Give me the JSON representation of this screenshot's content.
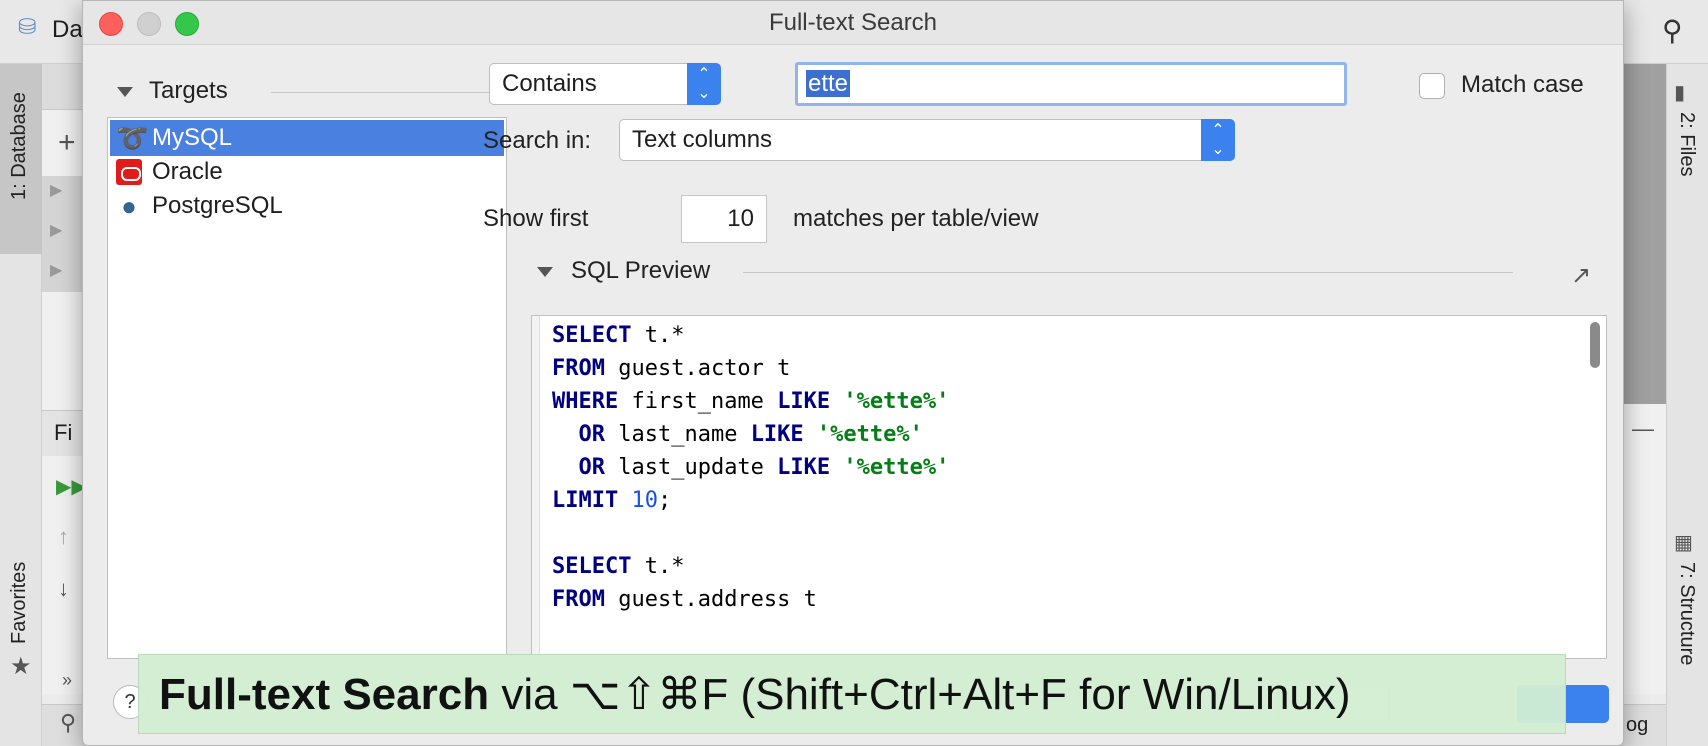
{
  "ide": {
    "left_tabs": {
      "database": "1: Database",
      "favorites": "Favorites"
    },
    "right_tabs": {
      "files": "2: Files",
      "structure": "7: Structure"
    },
    "db_panel_title": "Da",
    "find_panel_title": "Fi",
    "right_bottom_label": "og"
  },
  "dialog": {
    "title": "Full-text Search",
    "targets": {
      "header": "Targets",
      "items": [
        {
          "label": "MySQL",
          "icon": "mysql-dolphin-icon",
          "selected": true
        },
        {
          "label": "Oracle",
          "icon": "oracle-icon",
          "selected": false
        },
        {
          "label": "PostgreSQL",
          "icon": "postgresql-elephant-icon",
          "selected": false
        }
      ]
    },
    "match_mode": {
      "value": "Contains"
    },
    "search": {
      "value": "ette"
    },
    "match_case": {
      "label": "Match case",
      "checked": false
    },
    "search_in": {
      "label": "Search in:",
      "value": "Text columns"
    },
    "show_first": {
      "label": "Show first",
      "value": "10",
      "suffix": "matches per table/view"
    },
    "sql_preview": {
      "header": "SQL Preview",
      "lines": [
        {
          "kw1": "SELECT",
          "t1": " t.*"
        },
        {
          "kw1": "FROM",
          "t1": " guest.actor t"
        },
        {
          "kw1": "WHERE",
          "t1": " first_name ",
          "kw2": "LIKE",
          "t2": " ",
          "str": "'%ette%'"
        },
        {
          "kw1": "  OR",
          "t1": " last_name ",
          "kw2": "LIKE",
          "t2": " ",
          "str": "'%ette%'"
        },
        {
          "kw1": "  OR",
          "t1": " last_update ",
          "kw2": "LIKE",
          "t2": " ",
          "str": "'%ette%'"
        },
        {
          "kw1": "LIMIT",
          "t1": " ",
          "num": "10",
          "t3": ";"
        },
        {
          "kw1": "",
          "t1": ""
        },
        {
          "kw1": "SELECT",
          "t1": " t.*"
        },
        {
          "kw1": "FROM",
          "t1": " guest.address t"
        }
      ]
    },
    "help_label": "?"
  },
  "caption": {
    "bold": "Full-text Search",
    "rest": " via ⌥⇧⌘F (Shift+Ctrl+Alt+F for Win/Linux)"
  },
  "colors": {
    "selection": "#4a81e0",
    "accent": "#3b82ee",
    "keyword": "#000080",
    "string": "#067d17",
    "number": "#1750eb",
    "caption_bg": "#d2eed2"
  }
}
